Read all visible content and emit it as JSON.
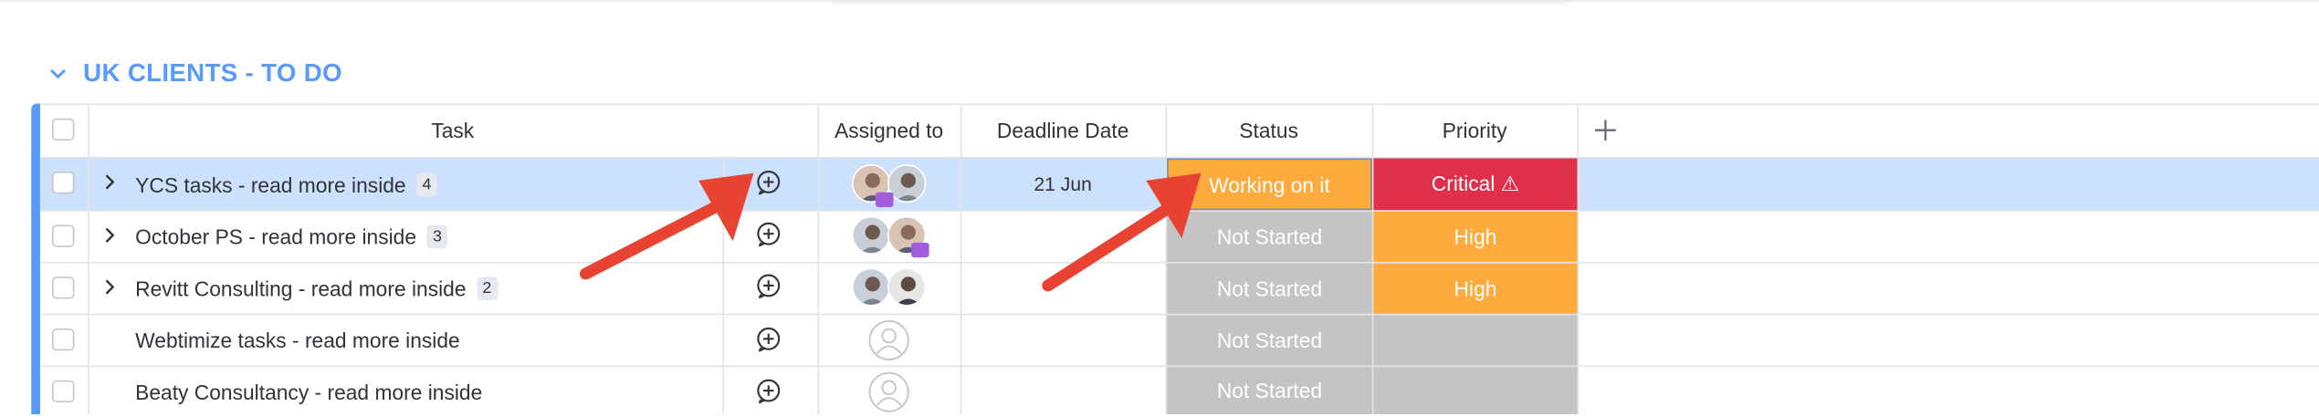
{
  "group": {
    "title": "UK CLIENTS - TO DO",
    "color": "#579bfc"
  },
  "columns": {
    "task": "Task",
    "assigned": "Assigned to",
    "deadline": "Deadline Date",
    "status": "Status",
    "priority": "Priority",
    "add": "+"
  },
  "rows": [
    {
      "task": "YCS tasks - read more inside",
      "subitems": "4",
      "deadline": "21 Jun",
      "status": "Working on it",
      "status_color": "#fdab3d",
      "priority": "Critical ⚠",
      "priority_color": "#df2f4a",
      "expandable": true,
      "selected": true
    },
    {
      "task": "October PS - read more inside",
      "subitems": "3",
      "deadline": "",
      "status": "Not Started",
      "status_color": "#c4c4c4",
      "priority": "High",
      "priority_color": "#fdab3d",
      "expandable": true
    },
    {
      "task": "Revitt Consulting - read more inside",
      "subitems": "2",
      "deadline": "",
      "status": "Not Started",
      "status_color": "#c4c4c4",
      "priority": "High",
      "priority_color": "#fdab3d",
      "expandable": true
    },
    {
      "task": "Webtimize tasks - read more inside",
      "subitems": "",
      "deadline": "",
      "status": "Not Started",
      "status_color": "#c4c4c4",
      "priority": "",
      "priority_color": "#c4c4c4",
      "expandable": false
    },
    {
      "task": "Beaty Consultancy - read more inside",
      "subitems": "",
      "deadline": "",
      "status": "Not Started",
      "status_color": "#c4c4c4",
      "priority": "",
      "priority_color": "#c4c4c4",
      "expandable": false
    }
  ],
  "annotation_color": "#e84233"
}
